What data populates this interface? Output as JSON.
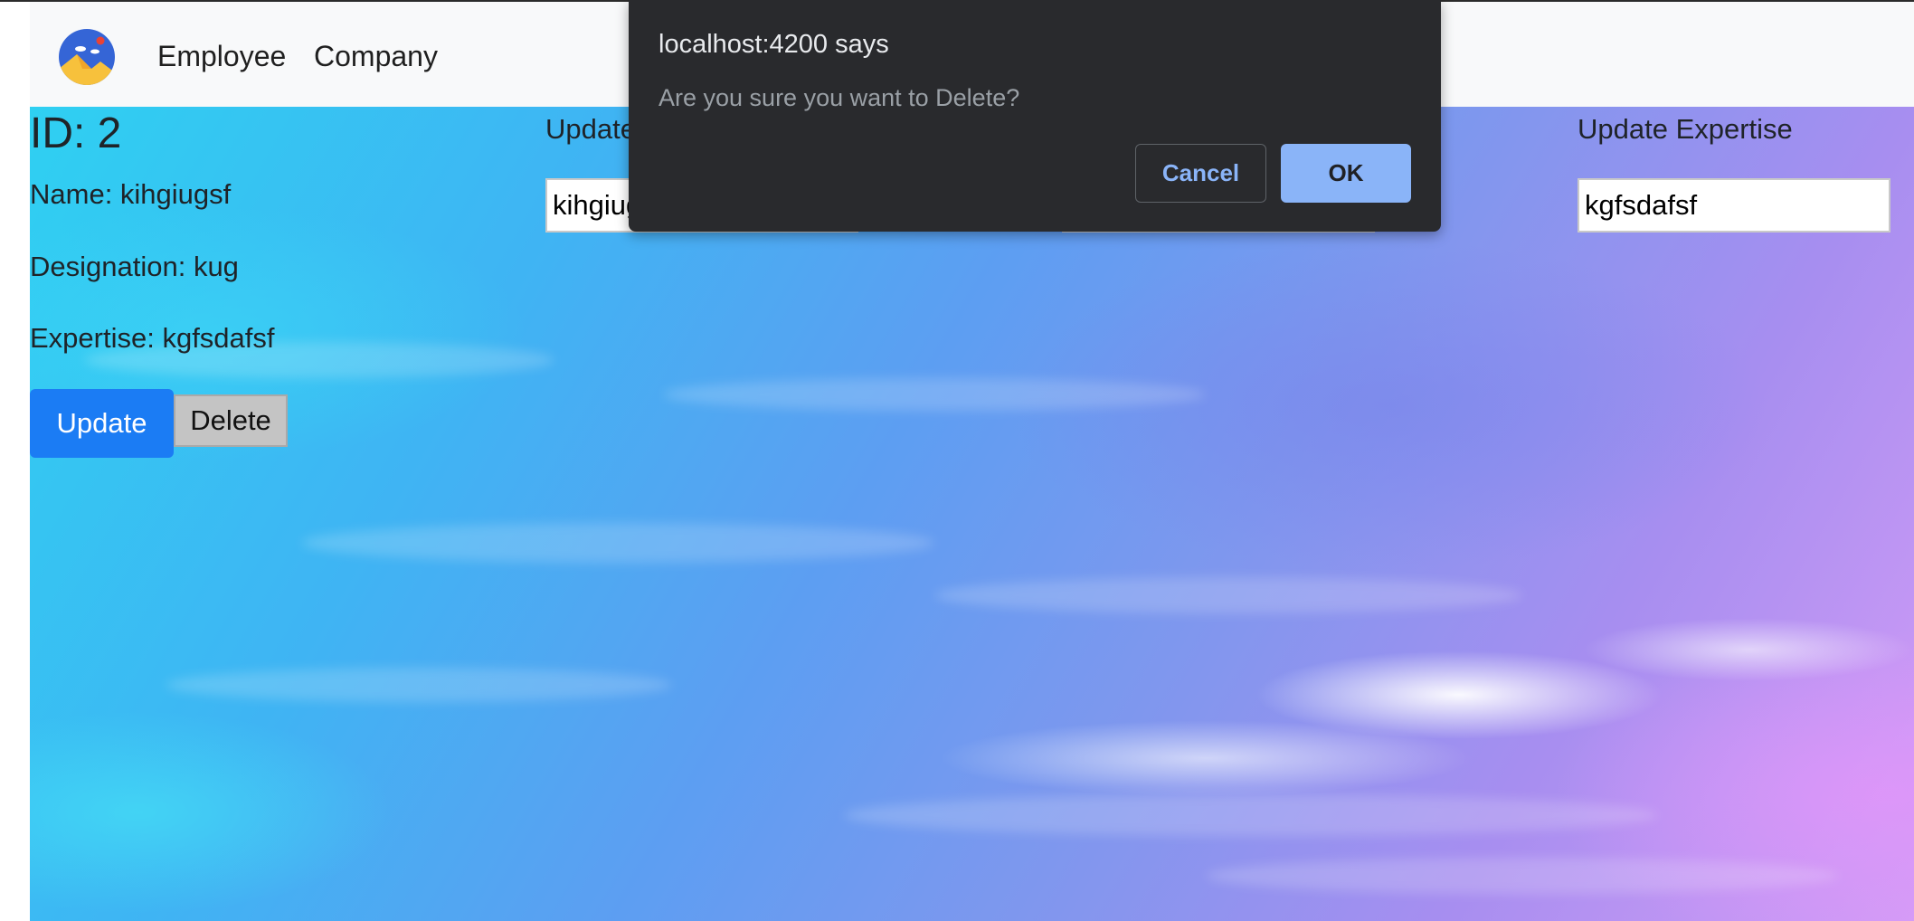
{
  "navbar": {
    "logo_icon": "photo-landscape-icon",
    "links": [
      "Employee",
      "Company"
    ]
  },
  "employee": {
    "id_label": "ID: 2",
    "name_line": "Name: kihgiugsf",
    "designation_line": "Designation: kug",
    "expertise_line": "Expertise: kgfsdafsf"
  },
  "actions": {
    "update_label": "Update",
    "delete_label": "Delete"
  },
  "form": {
    "name_label": "Update",
    "name_value": "kihgiugsf",
    "expertise_label": "Update Expertise",
    "expertise_value": "kgfsdafsf"
  },
  "dialog": {
    "title": "localhost:4200 says",
    "message": "Are you sure you want to Delete?",
    "cancel_label": "Cancel",
    "ok_label": "OK"
  },
  "colors": {
    "primary": "#1b7cf4",
    "dialog_bg": "#292a2d",
    "dialog_accent": "#8ab4f8"
  }
}
